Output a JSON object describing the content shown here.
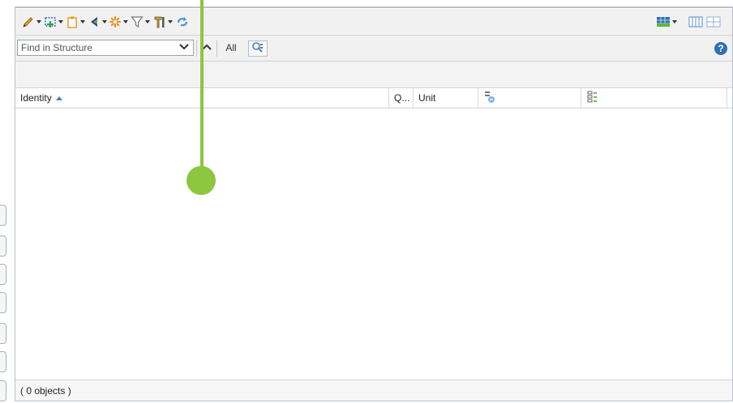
{
  "toolbar": {
    "icons": [
      "pencil-icon",
      "insert-icon",
      "clipboard-icon",
      "tag-icon",
      "burst-icon",
      "filter-icon",
      "tools-icon",
      "refresh-icon",
      "layout-icon",
      "columns-icon",
      "grid-icon"
    ]
  },
  "search": {
    "placeholder": "Find in Structure",
    "all_label": "All"
  },
  "help_label": "?",
  "table": {
    "columns": [
      {
        "label": "Identity",
        "sort": "ascending"
      },
      {
        "label": "Q..."
      },
      {
        "label": "Unit"
      },
      {
        "label": ""
      },
      {
        "label": ""
      }
    ],
    "rows": []
  },
  "status": {
    "text": "( 0 objects )"
  },
  "colors": {
    "accent": "#8dc63f",
    "help": "#2f6fb6"
  }
}
